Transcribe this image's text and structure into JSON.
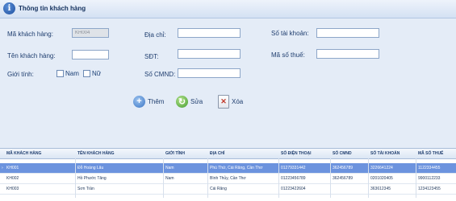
{
  "window": {
    "title": "Thông tin khách hàng"
  },
  "form": {
    "ma_kh_label": "Mã khách hàng:",
    "ma_kh_value": "KH004",
    "ten_kh_label": "Tên khách hàng:",
    "ten_kh_value": "",
    "gioi_tinh_label": "Giới tính:",
    "nam_label": "Nam",
    "nu_label": "Nữ",
    "dia_chi_label": "Địa chỉ:",
    "dia_chi_value": "",
    "sdt_label": "SĐT:",
    "sdt_value": "",
    "so_cmnd_label": "Số CMND:",
    "so_cmnd_value": "",
    "so_tk_label": "Số tài khoản:",
    "so_tk_value": "",
    "ma_so_thue_label": "Mã số thuế:",
    "ma_so_thue_value": ""
  },
  "toolbar": {
    "them_label": "Thêm",
    "sua_label": "Sửa",
    "xoa_label": "Xóa"
  },
  "colors": {
    "accent": "#6c93de",
    "background": "#e4ecf7",
    "text": "#1e3d6e"
  },
  "table": {
    "headers": [
      "MÃ KHÁCH HÀNG",
      "TÊN KHÁCH HÀNG",
      "GIỚI TÍNH",
      "ĐỊA CHỈ",
      "SỐ ĐIỆN THOẠI",
      "SỐ CMND",
      "SỐ TÀI KHOẢN",
      "MÃ SỐ THUẾ"
    ],
    "rows": [
      {
        "ma": "KH001",
        "ten": "Đỗ Hoàng Lâu",
        "gioi_tinh": "Nam",
        "dia_chi": "Phú Thứ, Cái Răng, Cần Thơ",
        "sdt": "01279331442",
        "cmnd": "362456789",
        "so_tk": "3226641224",
        "mst": "1122334455"
      },
      {
        "ma": "KH002",
        "ten": "Hồ Phước Tăng",
        "gioi_tinh": "Nam",
        "dia_chi": "Bình Thủy, Cần Thơ",
        "sdt": "01223456789",
        "cmnd": "362456789",
        "so_tk": "0201020405",
        "mst": "9900112233"
      },
      {
        "ma": "KH003",
        "ten": "Sơn Trần",
        "gioi_tinh": "",
        "dia_chi": "Cái Răng",
        "sdt": "01223422604",
        "cmnd": "",
        "so_tk": "363612345",
        "mst": "1234123455"
      }
    ]
  }
}
